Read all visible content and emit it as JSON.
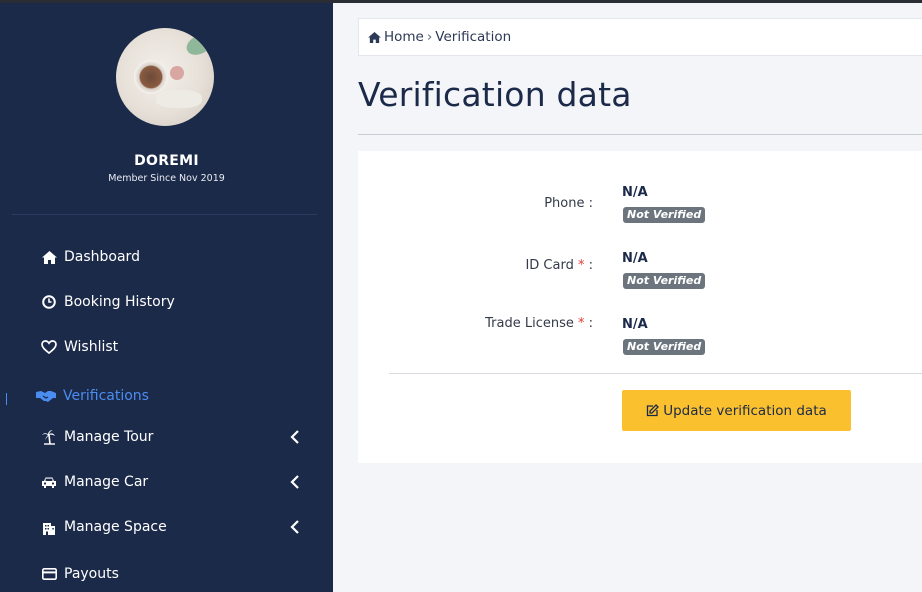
{
  "sidebar": {
    "user_name": "DOREMI",
    "member_since": "Member Since Nov 2019",
    "items": [
      {
        "label": "Dashboard",
        "icon": "home-icon"
      },
      {
        "label": "Booking History",
        "icon": "clock-icon"
      },
      {
        "label": "Wishlist",
        "icon": "heart-icon"
      },
      {
        "label": "Verifications",
        "icon": "handshake-icon",
        "active": true
      },
      {
        "label": "Manage Tour",
        "icon": "palm-tree-icon",
        "expandable": true
      },
      {
        "label": "Manage Car",
        "icon": "car-icon",
        "expandable": true
      },
      {
        "label": "Manage Space",
        "icon": "building-icon",
        "expandable": true
      },
      {
        "label": "Payouts",
        "icon": "credit-card-icon"
      }
    ]
  },
  "breadcrumb": {
    "home": "Home",
    "separator": "›",
    "current": "Verification"
  },
  "page": {
    "title": "Verification data"
  },
  "verification": {
    "fields": [
      {
        "label": "Phone :",
        "required": false,
        "value": "N/A",
        "status": "Not Verified"
      },
      {
        "label": "ID Card",
        "required": true,
        "required_mark": "*",
        "suffix": " :",
        "value": "N/A",
        "status": "Not Verified"
      },
      {
        "label": "Trade License",
        "required": true,
        "required_mark": "*",
        "suffix": " :",
        "value": "N/A",
        "status": "Not Verified"
      }
    ],
    "update_button": "Update verification data"
  },
  "colors": {
    "sidebar_bg": "#1c2a4a",
    "active": "#4a8df0",
    "button": "#fbc02d",
    "badge": "#6c757d",
    "required": "#e53935"
  }
}
